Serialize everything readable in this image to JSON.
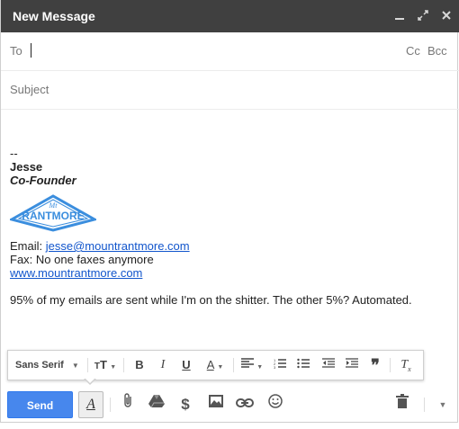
{
  "window": {
    "title": "New Message"
  },
  "titlebar_icons": [
    "minimize-icon",
    "expand-icon",
    "close-icon"
  ],
  "to": {
    "label": "To",
    "cc": "Cc",
    "bcc": "Bcc"
  },
  "subject": {
    "placeholder": "Subject"
  },
  "body": {
    "dashes": "--",
    "name": "Jesse",
    "role": "Co-Founder",
    "logo_text": "RANTMORE",
    "email_label": "Email:",
    "email": "jesse@mountrantmore.com",
    "fax": "Fax: No one faxes anymore",
    "website": "www.mountrantmore.com",
    "tagline": "95% of my emails are sent while I'm on the shitter. The other 5%? Automated."
  },
  "format_bar": {
    "font": "Sans Serif",
    "tools": [
      "font-size",
      "bold",
      "italic",
      "underline",
      "text-color",
      "align",
      "numbered-list",
      "bulleted-list",
      "indent-less",
      "indent-more",
      "quote",
      "remove-formatting"
    ]
  },
  "bottom": {
    "send": "Send"
  },
  "colors": {
    "titlebar": "#404040",
    "send": "#4787ed",
    "link": "#1155cc",
    "logo": "#3b8ede"
  }
}
